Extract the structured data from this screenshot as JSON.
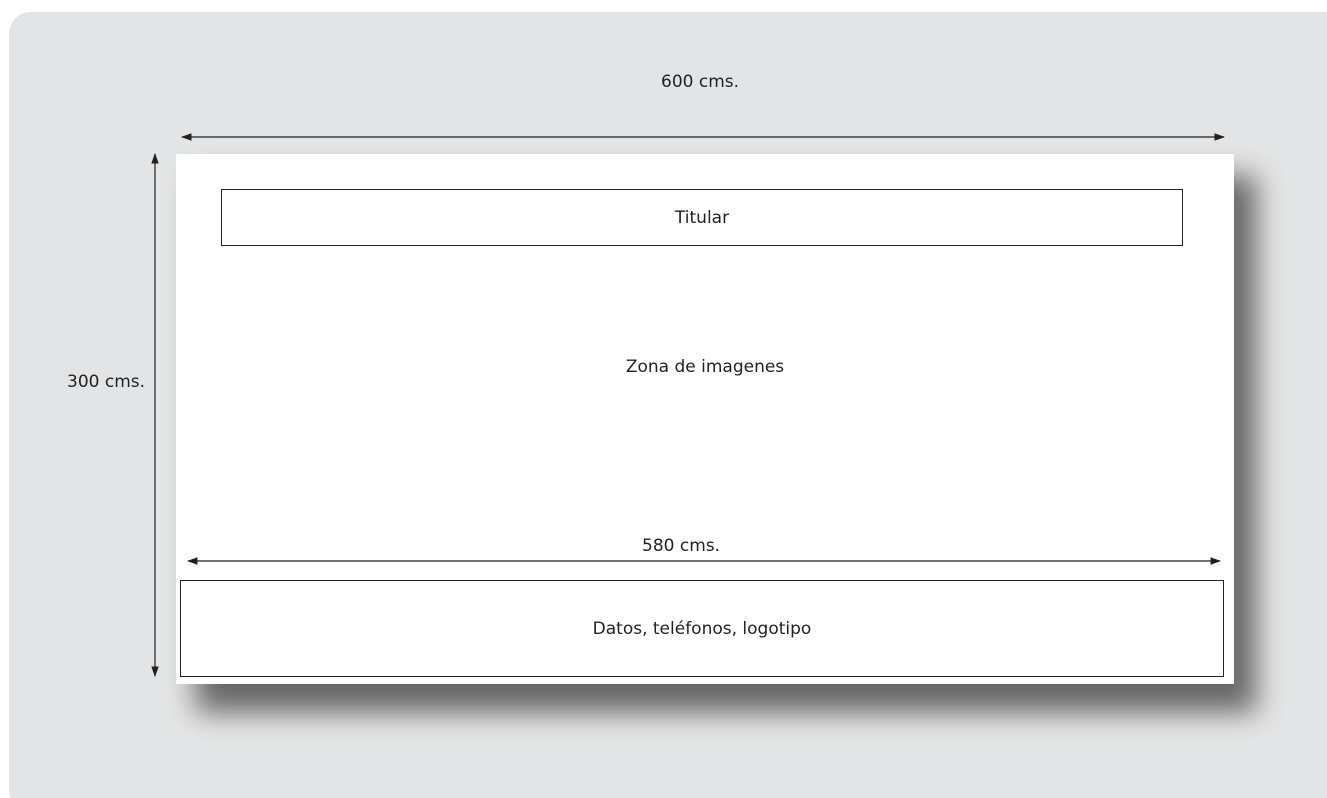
{
  "diagram": {
    "width_label": "600 cms.",
    "height_label": "300 cms.",
    "inner_width_label": "580  cms.",
    "zones": {
      "headline": "Titular",
      "images": "Zona de imagenes",
      "footer": "Datos, teléfonos, logotipo"
    }
  }
}
